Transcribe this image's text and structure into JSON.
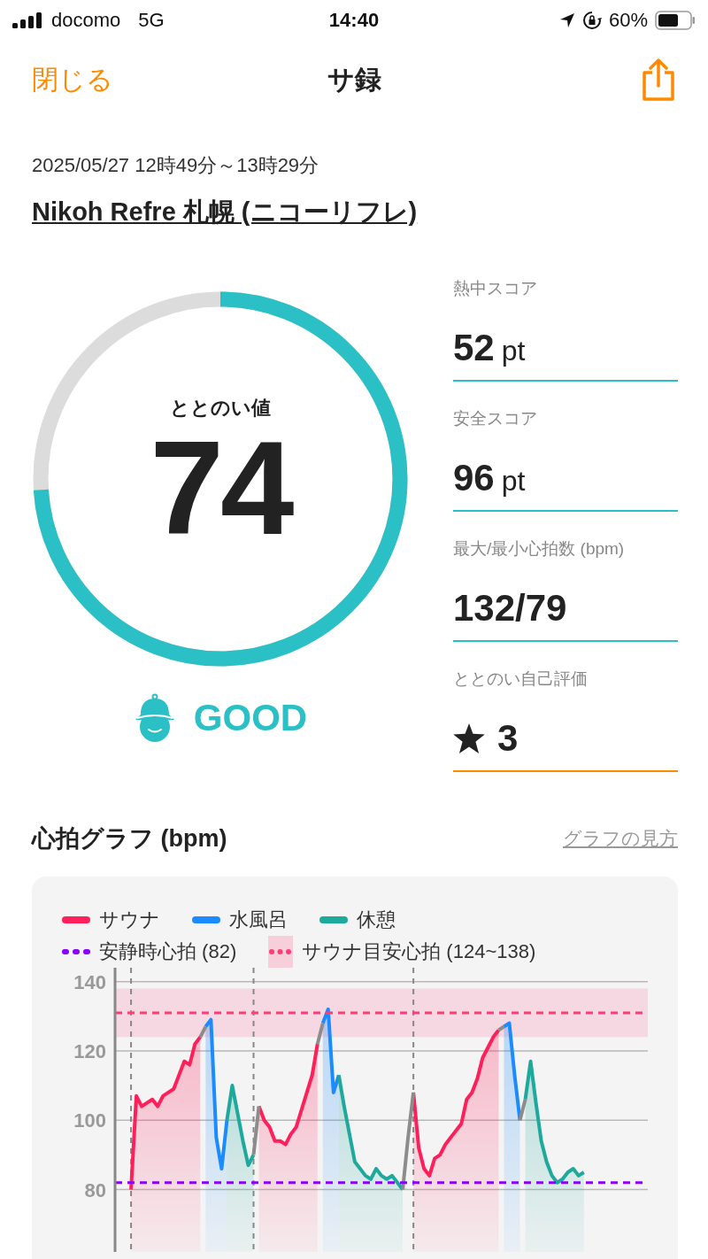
{
  "status_bar": {
    "carrier": "docomo",
    "network": "5G",
    "time": "14:40",
    "battery": "60%"
  },
  "nav": {
    "close": "閉じる",
    "title": "サ録"
  },
  "session": {
    "datetime": "2025/05/27 12時49分～13時29分",
    "place": "Nikoh Refre 札幌 (ニコーリフレ)"
  },
  "score": {
    "label": "ととのい値",
    "value": "74",
    "level": 0.74,
    "rating": "GOOD"
  },
  "metrics": [
    {
      "kind": "score",
      "label": "熱中スコア",
      "value": "52",
      "unit": "pt"
    },
    {
      "kind": "score",
      "label": "安全スコア",
      "value": "96",
      "unit": "pt"
    },
    {
      "kind": "plain",
      "label": "最大/最小心拍数 (bpm)",
      "value": "132/79"
    },
    {
      "kind": "rating",
      "label": "ととのい自己評価",
      "value": "3"
    }
  ],
  "heart_graph": {
    "title": "心拍グラフ (bpm)",
    "help_link": "グラフの見方",
    "legend": [
      {
        "kind": "line",
        "label": "サウナ",
        "color": "#ff1f5a"
      },
      {
        "kind": "line",
        "label": "水風呂",
        "color": "#1a8cff"
      },
      {
        "kind": "line",
        "label": "休憩",
        "color": "#1fa89c"
      },
      {
        "kind": "dotted",
        "label": "安静時心拍 (82)",
        "color": "#8a00ff"
      },
      {
        "kind": "band",
        "label": "サウナ目安心拍 (124~138)",
        "color": "#ff3d78"
      }
    ],
    "y_axis_labels": [
      "140",
      "120",
      "100",
      "80"
    ]
  }
}
